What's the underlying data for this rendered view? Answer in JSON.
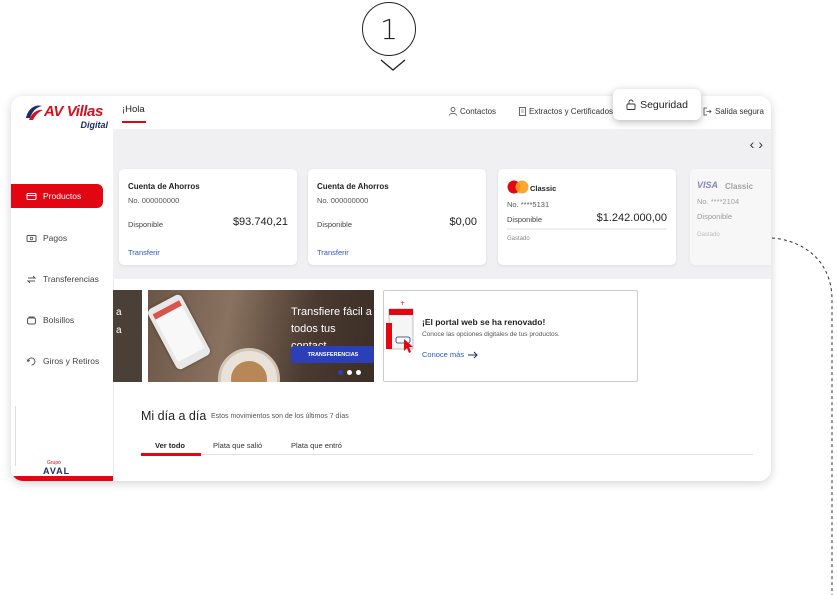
{
  "step": {
    "number": "1"
  },
  "brand": {
    "name": "AV Villas",
    "sub": "Digital",
    "group": "AVAL",
    "group_prefix": "Grupo"
  },
  "header": {
    "greeting": "¡Hola",
    "contacts": "Contactos",
    "statements": "Extractos y Certificados",
    "security": "Seguridad",
    "logout": "Salida segura"
  },
  "sidebar": {
    "items": [
      {
        "label": "Productos",
        "icon": "card-icon"
      },
      {
        "label": "Pagos",
        "icon": "bill-icon"
      },
      {
        "label": "Transferencias",
        "icon": "transfer-icon"
      },
      {
        "label": "Bolsillos",
        "icon": "wallet-icon"
      },
      {
        "label": "Giros y Retiros",
        "icon": "money-icon"
      }
    ]
  },
  "cards": [
    {
      "title": "Cuenta de Ahorros",
      "number": "No. 000000000",
      "available_label": "Disponible",
      "amount": "$93.740,21",
      "link": "Transferir"
    },
    {
      "title": "Cuenta de Ahorros",
      "number": "No. 000000000",
      "available_label": "Disponible",
      "amount": "$0,00",
      "link": "Transferir"
    },
    {
      "title": "Classic",
      "number": "No. ****5131",
      "available_label": "Disponible",
      "amount": "$1.242.000,00",
      "spent_label": "Gastado"
    },
    {
      "brand": "VISA",
      "title": "Classic",
      "number": "No. ****2104",
      "available_label": "Disponible",
      "spent_label": "Gastado"
    }
  ],
  "banners": {
    "left_text": [
      "a",
      "a"
    ],
    "mid_text": [
      "Transfiere fácil a",
      "todos tus contact"
    ],
    "mid_button": "TRANSFERENCIAS",
    "right_title": "¡El portal web se ha renovado!",
    "right_sub": "Conoce las opciones digitales de tus productos.",
    "right_link": "Conoce más"
  },
  "activity": {
    "title": "Mi día a día",
    "subtitle": "Estos movimientos son de los últimos 7 días",
    "tabs": [
      "Ver todo",
      "Plata que salió",
      "Plata que entró"
    ]
  },
  "colors": {
    "brand_red": "#e20613",
    "link_blue": "#2a56c6",
    "navy": "#1d2d66"
  }
}
